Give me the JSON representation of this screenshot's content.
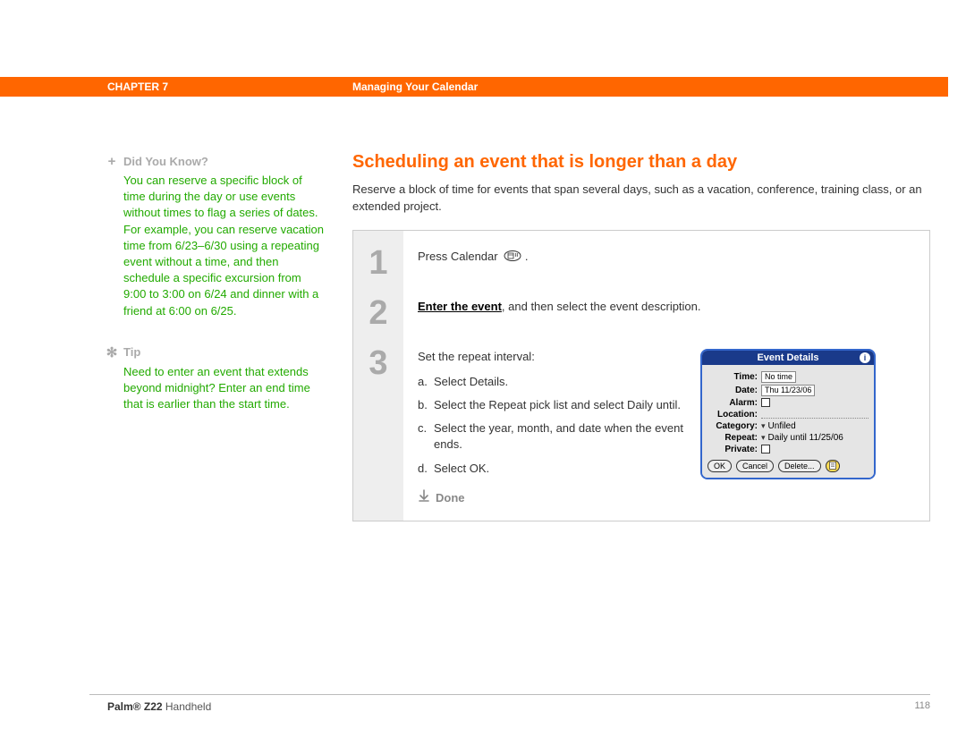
{
  "header": {
    "chapter_label": "CHAPTER 7",
    "chapter_title": "Managing Your Calendar"
  },
  "sidebar": {
    "dyk": {
      "heading": "Did You Know?",
      "body": "You can reserve a specific block of time during the day or use events without times to flag a series of dates. For example, you can reserve vacation time from 6/23–6/30 using a repeating event without a time, and then schedule a specific excursion from 9:00 to 3:00 on 6/24 and dinner with a friend at 6:00 on 6/25."
    },
    "tip": {
      "heading": "Tip",
      "body": "Need to enter an event that extends beyond midnight? Enter an end time that is earlier than the start time."
    }
  },
  "main": {
    "title": "Scheduling an event that is longer than a day",
    "intro": "Reserve a block of time for events that span several days, such as a vacation, conference, training class, or an extended project.",
    "steps": {
      "nums": [
        "1",
        "2",
        "3"
      ],
      "s1_prefix": "Press Calendar ",
      "s1_suffix": ".",
      "s2_link": "Enter the event",
      "s2_tail": ", and then select the event description.",
      "s3_lead": "Set the repeat interval:",
      "s3_items": [
        {
          "letter": "a.",
          "text": "Select Details."
        },
        {
          "letter": "b.",
          "text": "Select the Repeat pick list and select Daily until."
        },
        {
          "letter": "c.",
          "text": "Select the year, month, and date when the event ends."
        },
        {
          "letter": "d.",
          "text": "Select OK."
        }
      ],
      "done_label": "Done"
    }
  },
  "device": {
    "title": "Event Details",
    "time_label": "Time:",
    "time_value": "No time",
    "date_label": "Date:",
    "date_value": "Thu 11/23/06",
    "alarm_label": "Alarm:",
    "location_label": "Location:",
    "category_label": "Category:",
    "category_value": "Unfiled",
    "repeat_label": "Repeat:",
    "repeat_value": "Daily until 11/25/06",
    "private_label": "Private:",
    "btn_ok": "OK",
    "btn_cancel": "Cancel",
    "btn_delete": "Delete..."
  },
  "footer": {
    "product": "Palm® Z22",
    "product_tail": " Handheld",
    "page": "118"
  }
}
